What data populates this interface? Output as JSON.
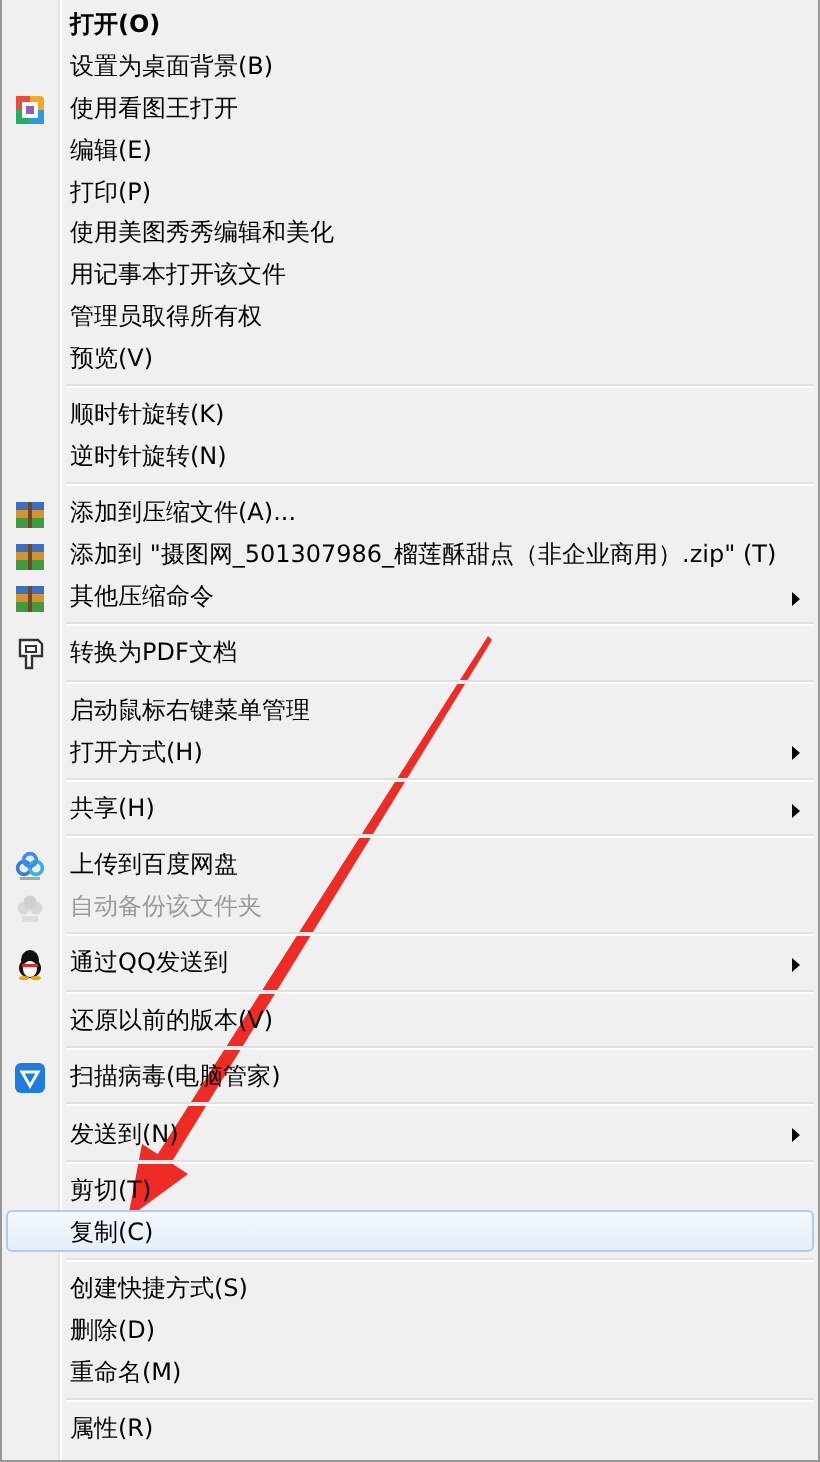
{
  "menu": {
    "groups": [
      [
        {
          "label": "打开(O)",
          "default": true,
          "submenu": false,
          "disabled": false,
          "selected": false
        },
        {
          "label": "设置为桌面背景(B)",
          "default": false,
          "submenu": false,
          "disabled": false,
          "selected": false
        },
        {
          "label": "使用看图王打开",
          "default": false,
          "submenu": false,
          "disabled": false,
          "selected": false
        },
        {
          "label": "编辑(E)",
          "default": false,
          "submenu": false,
          "disabled": false,
          "selected": false
        },
        {
          "label": "打印(P)",
          "default": false,
          "submenu": false,
          "disabled": false,
          "selected": false
        },
        {
          "label": "使用美图秀秀编辑和美化",
          "default": false,
          "submenu": false,
          "disabled": false,
          "selected": false
        },
        {
          "label": "用记事本打开该文件",
          "default": false,
          "submenu": false,
          "disabled": false,
          "selected": false
        },
        {
          "label": "管理员取得所有权",
          "default": false,
          "submenu": false,
          "disabled": false,
          "selected": false
        },
        {
          "label": "预览(V)",
          "default": false,
          "submenu": false,
          "disabled": false,
          "selected": false
        }
      ],
      [
        {
          "label": "顺时针旋转(K)",
          "default": false,
          "submenu": false,
          "disabled": false,
          "selected": false
        },
        {
          "label": "逆时针旋转(N)",
          "default": false,
          "submenu": false,
          "disabled": false,
          "selected": false
        }
      ],
      [
        {
          "label": "添加到压缩文件(A)...",
          "default": false,
          "submenu": false,
          "disabled": false,
          "selected": false
        },
        {
          "label": "添加到 \"摄图网_501307986_榴莲酥甜点（非企业商用）.zip\" (T)",
          "default": false,
          "submenu": false,
          "disabled": false,
          "selected": false
        },
        {
          "label": "其他压缩命令",
          "default": false,
          "submenu": true,
          "disabled": false,
          "selected": false
        }
      ],
      [
        {
          "label": "转换为PDF文档",
          "default": false,
          "submenu": false,
          "disabled": false,
          "selected": false
        }
      ],
      [
        {
          "label": "启动鼠标右键菜单管理",
          "default": false,
          "submenu": false,
          "disabled": false,
          "selected": false
        },
        {
          "label": "打开方式(H)",
          "default": false,
          "submenu": true,
          "disabled": false,
          "selected": false
        }
      ],
      [
        {
          "label": "共享(H)",
          "default": false,
          "submenu": true,
          "disabled": false,
          "selected": false
        }
      ],
      [
        {
          "label": "上传到百度网盘",
          "default": false,
          "submenu": false,
          "disabled": false,
          "selected": false
        },
        {
          "label": "自动备份该文件夹",
          "default": false,
          "submenu": false,
          "disabled": true,
          "selected": false
        }
      ],
      [
        {
          "label": "通过QQ发送到",
          "default": false,
          "submenu": true,
          "disabled": false,
          "selected": false
        }
      ],
      [
        {
          "label": "还原以前的版本(V)",
          "default": false,
          "submenu": false,
          "disabled": false,
          "selected": false
        }
      ],
      [
        {
          "label": "扫描病毒(电脑管家)",
          "default": false,
          "submenu": false,
          "disabled": false,
          "selected": false
        }
      ],
      [
        {
          "label": "发送到(N)",
          "default": false,
          "submenu": true,
          "disabled": false,
          "selected": false
        }
      ],
      [
        {
          "label": "剪切(T)",
          "default": false,
          "submenu": false,
          "disabled": false,
          "selected": false
        },
        {
          "label": "复制(C)",
          "default": false,
          "submenu": false,
          "disabled": false,
          "selected": true
        }
      ],
      [
        {
          "label": "创建快捷方式(S)",
          "default": false,
          "submenu": false,
          "disabled": false,
          "selected": false
        },
        {
          "label": "删除(D)",
          "default": false,
          "submenu": false,
          "disabled": false,
          "selected": false
        },
        {
          "label": "重命名(M)",
          "default": false,
          "submenu": false,
          "disabled": false,
          "selected": false
        }
      ],
      [
        {
          "label": "属性(R)",
          "default": false,
          "submenu": false,
          "disabled": false,
          "selected": false
        }
      ]
    ]
  }
}
